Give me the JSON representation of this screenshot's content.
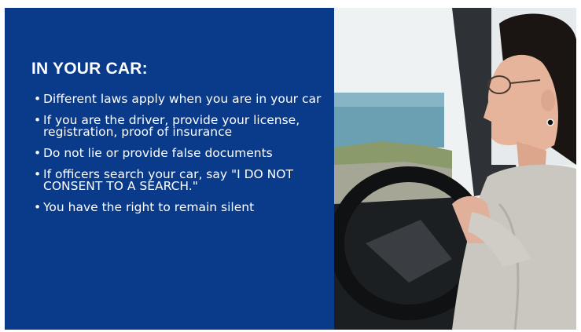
{
  "slide": {
    "title": "IN YOUR CAR:",
    "bullets": [
      "Different laws apply when you are in your car",
      "If you are the driver, provide your license, registration, proof of insurance",
      "Do not lie or provide false documents",
      "If officers search your car, say \"I DO NOT CONSENT TO A SEARCH.\"",
      "You have the right to remain silent"
    ],
    "bullet_glyph": "•"
  },
  "colors": {
    "panel": "#0a3a8a",
    "text": "#ffffff"
  }
}
